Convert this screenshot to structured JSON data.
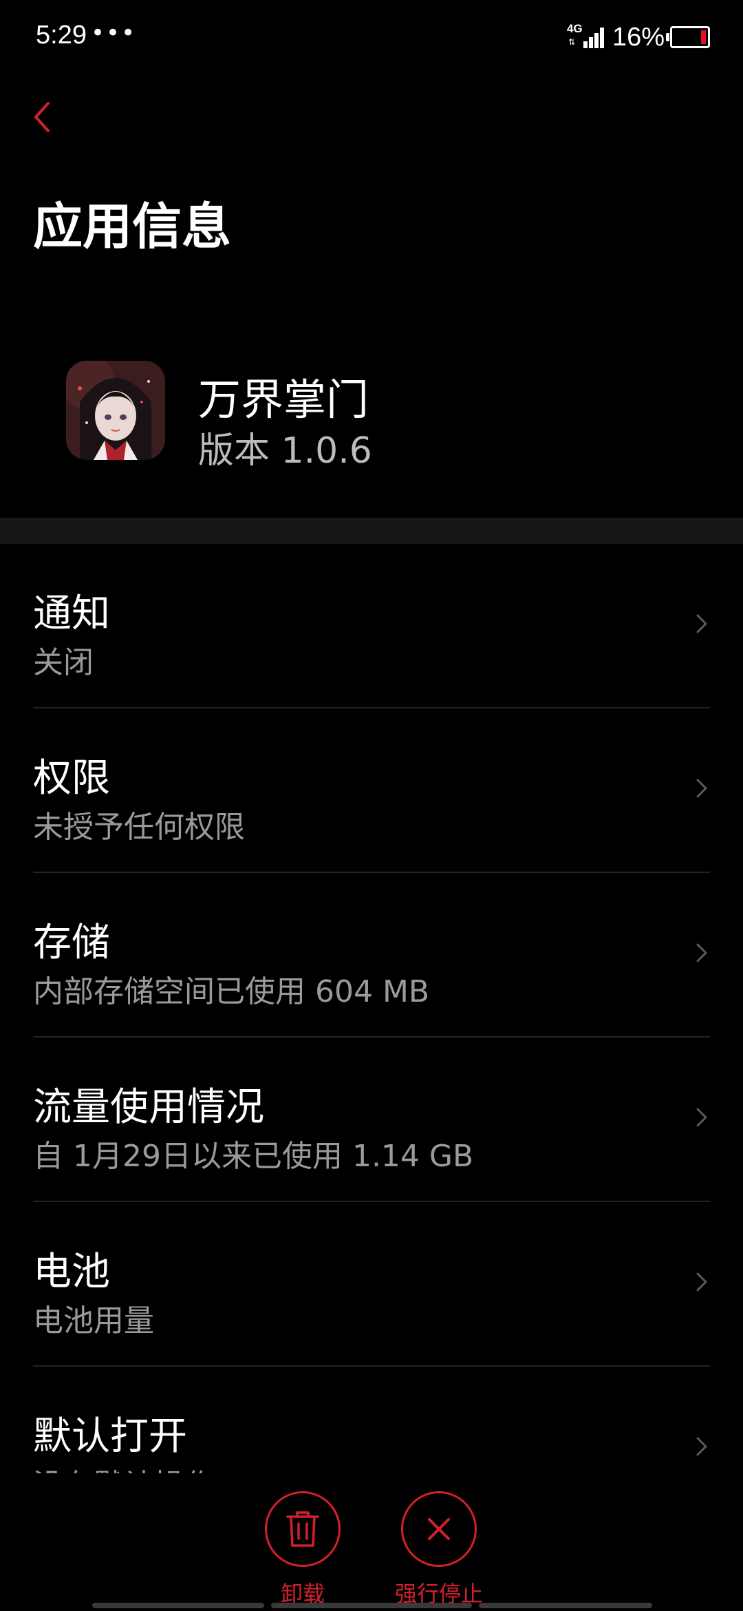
{
  "status_bar": {
    "time": "5:29",
    "dots": "•••",
    "network": "4G",
    "battery_percent": "16%",
    "battery_level": 0.16
  },
  "header": {
    "back_icon": "chevron-left-icon",
    "title": "应用信息"
  },
  "app": {
    "name": "万界掌门",
    "version": "版本 1.0.6"
  },
  "settings": [
    {
      "title": "通知",
      "subtitle": "关闭"
    },
    {
      "title": "权限",
      "subtitle": "未授予任何权限"
    },
    {
      "title": "存储",
      "subtitle": "内部存储空间已使用 604 MB"
    },
    {
      "title": "流量使用情况",
      "subtitle": "自 1月29日以来已使用 1.14 GB"
    },
    {
      "title": "电池",
      "subtitle": "电池用量"
    },
    {
      "title": "默认打开",
      "subtitle": "没有默认操作"
    }
  ],
  "actions": {
    "uninstall": "卸载",
    "force_stop": "强行停止"
  },
  "colors": {
    "accent": "#d4202c",
    "background": "#000000",
    "battery_low": "#e0141e"
  }
}
